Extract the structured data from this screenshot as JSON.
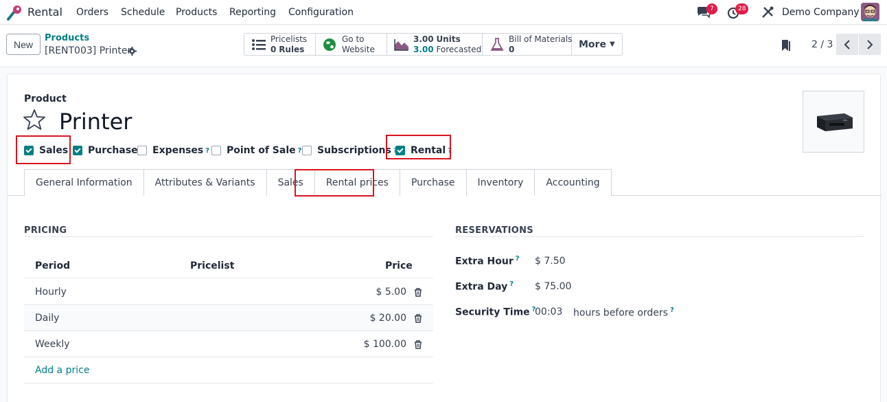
{
  "nav": {
    "app_name": "Rental",
    "menus": [
      "Orders",
      "Schedule",
      "Products",
      "Reporting",
      "Configuration"
    ],
    "chat_count": "7",
    "activity_count": "28",
    "company": "Demo Company"
  },
  "control": {
    "new_label": "New",
    "breadcrumb_parent": "Products",
    "breadcrumb_current": "[RENT003] Printer",
    "smart_buttons": [
      {
        "line1": "Pricelists",
        "line2_value": "0",
        "line2_label": "Rules",
        "icon": "list-icon"
      },
      {
        "line1": "Go to",
        "line2_label": "Website",
        "icon": "globe-icon"
      },
      {
        "line1_value": "3.00",
        "line1_label": "Units",
        "line2_value": "3.00",
        "line2_label": "Forecasted",
        "icon": "chart-icon"
      },
      {
        "line1": "Bill of Materials",
        "line2_value": "0",
        "icon": "flask-icon"
      }
    ],
    "more_label": "More",
    "pager": "2 / 3"
  },
  "form": {
    "product_label": "Product",
    "name": "Printer",
    "checkboxes": [
      {
        "label": "Sales",
        "checked": true,
        "help": false
      },
      {
        "label": "Purchase",
        "checked": true,
        "help": false
      },
      {
        "label": "Expenses",
        "checked": false,
        "help": true
      },
      {
        "label": "Point of Sale",
        "checked": false,
        "help": true
      },
      {
        "label": "Subscriptions",
        "checked": false,
        "help": true
      },
      {
        "label": "Rental",
        "checked": true,
        "help": true
      }
    ],
    "tabs": [
      "General Information",
      "Attributes & Variants",
      "Sales",
      "Rental prices",
      "Purchase",
      "Inventory",
      "Accounting"
    ],
    "active_tab": "Rental prices",
    "help_mark": "?"
  },
  "pricing": {
    "title": "PRICING",
    "headers": {
      "period": "Period",
      "pricelist": "Pricelist",
      "price": "Price"
    },
    "rows": [
      {
        "period": "Hourly",
        "pricelist": "",
        "price": "$ 5.00"
      },
      {
        "period": "Daily",
        "pricelist": "",
        "price": "$ 20.00"
      },
      {
        "period": "Weekly",
        "pricelist": "",
        "price": "$ 100.00"
      }
    ],
    "add_label": "Add a price"
  },
  "reservations": {
    "title": "RESERVATIONS",
    "extra_hour_label": "Extra Hour",
    "extra_hour_value": "$ 7.50",
    "extra_day_label": "Extra Day",
    "extra_day_value": "$ 75.00",
    "security_label": "Security Time",
    "security_value": "00:03",
    "security_suffix": "hours before orders"
  },
  "colors": {
    "accent": "#017e84",
    "highlight": "#d9131f",
    "badge": "#e11d48"
  }
}
